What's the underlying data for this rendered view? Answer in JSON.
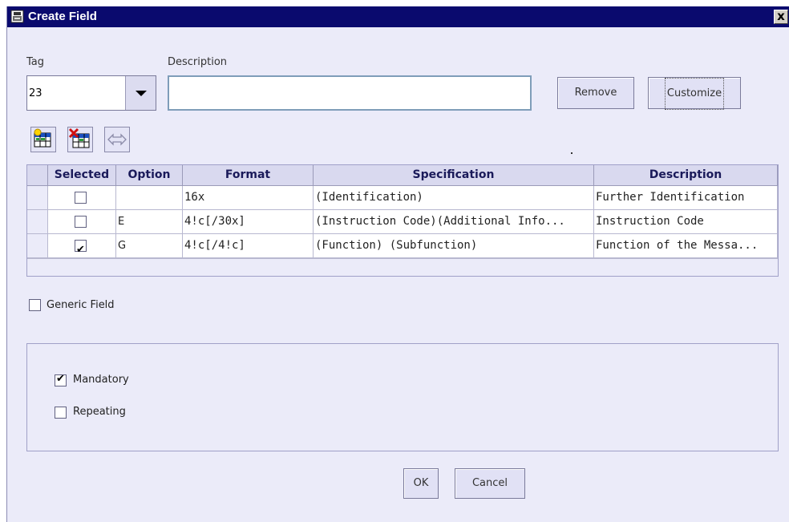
{
  "window": {
    "title": "Create Field",
    "close_glyph": "x",
    "title_icon": "app-icon"
  },
  "form": {
    "tag_label": "Tag",
    "tag_value": "23",
    "description_label": "Description",
    "description_value": "",
    "remove_label": "Remove",
    "customize_label": "Customize"
  },
  "toolbar": {
    "icons": [
      "add-row-icon",
      "delete-row-icon",
      "swap-icon"
    ]
  },
  "table": {
    "columns": [
      "Selected",
      "Option",
      "Format",
      "Specification",
      "Description"
    ],
    "rows": [
      {
        "selected": false,
        "option": "",
        "format": "16x",
        "specification": "(Identification)",
        "description": "Further Identification"
      },
      {
        "selected": false,
        "option": "E",
        "format": "4!c[/30x]",
        "specification": "(Instruction Code)(Additional Info...",
        "description": "Instruction Code"
      },
      {
        "selected": true,
        "option": "G",
        "format": "4!c[/4!c]",
        "specification": "(Function) (Subfunction)",
        "description": "Function of the Messa..."
      }
    ]
  },
  "options": {
    "generic_field_label": "Generic Field",
    "generic_field_checked": false,
    "mandatory_label": "Mandatory",
    "mandatory_checked": true,
    "repeating_label": "Repeating",
    "repeating_checked": false
  },
  "footer": {
    "ok_label": "OK",
    "cancel_label": "Cancel"
  },
  "colors": {
    "titlebar": "#0a0a6e",
    "background": "#ebebf9",
    "header": "#d9d9ef",
    "input_border": "#7f9db9"
  }
}
